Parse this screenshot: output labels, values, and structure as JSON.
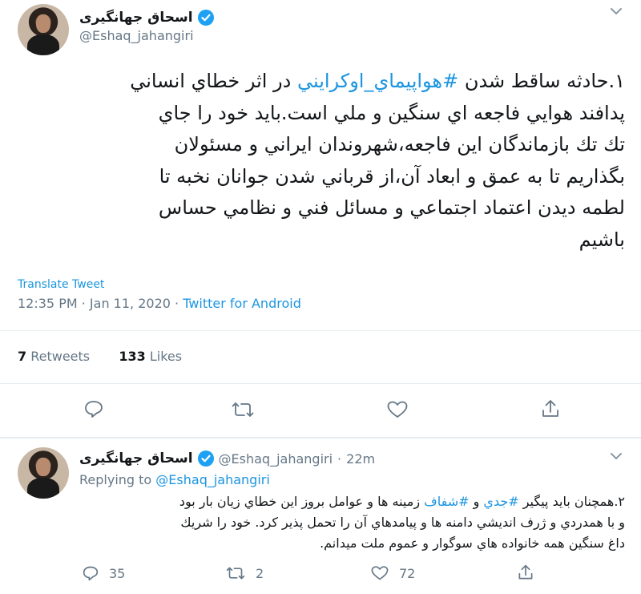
{
  "tweet": {
    "author_name": "اسحاق جهانگیری",
    "handle": "@Eshaq_jahangiri",
    "text_lines": [
      "۱.حادثه ساقط شدن #هواپيماي_اوكرايني در اثر خطاي انساني",
      "پدافند هوايي فاجعه اي سنگين و ملي است.بايد خود را جاي",
      "تك تك بازماندگان اين فاجعه،شهروندان ايراني و مسئولان",
      "بگذاريم تا به عمق و ابعاد آن،از قرباني شدن جوانان نخبه تا",
      "لطمه ديدن اعتماد اجتماعي و مسائل فني و نظامي حساس",
      "باشيم"
    ],
    "text_line1_before": "۱.حادثه ساقط شدن ",
    "hashtag": "#هواپيماي_اوكرايني",
    "text_line1_after": " در اثر خطاي انساني",
    "translate_label": "Translate Tweet",
    "time": "12:35 PM",
    "date": "Jan 11, 2020",
    "source": "Twitter for Android",
    "retweets_count": "7",
    "retweets_label": "Retweets",
    "likes_count": "133",
    "likes_label": "Likes"
  },
  "reply": {
    "author_name": "اسحاق جهانگیری",
    "handle": "@Eshaq_jahangiri",
    "time_ago": "22m",
    "replying_to_label": "Replying to",
    "replying_to_handle": "@Eshaq_jahangiri",
    "line1_before": "۲.همچنان بايد پيگير ",
    "hashtag1": "#جدي",
    "line1_mid": " و ",
    "hashtag2": "#شفاف",
    "line1_after": " زمينه ها و عوامل بروز اين خطاي زيان بار بود",
    "line2": "و با همدردي و ژرف انديشي دامنه ها و پيامدهاي آن را تحمل پذير كرد. خود را شريك",
    "line3": "داغ سنگين همه خانواده هاي سوگوار و عموم ملت ميدانم.",
    "replies": "35",
    "retweets": "2",
    "likes": "72"
  }
}
